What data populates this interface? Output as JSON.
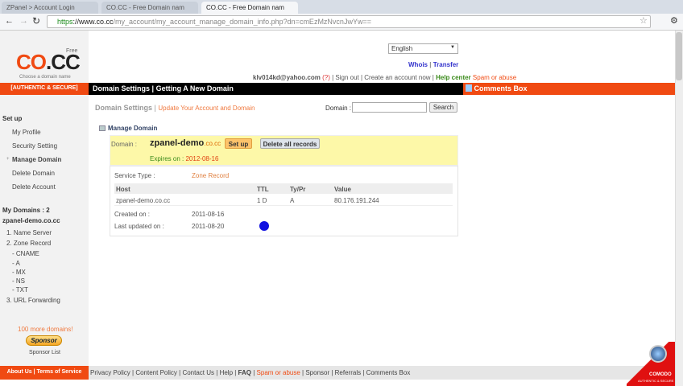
{
  "browser": {
    "tabs": [
      "ZPanel > Account Login",
      "CO.CC - Free Domain nam",
      "CO.CC - Free Domain nam"
    ],
    "url_scheme": "https",
    "url_host": "://www.co.cc",
    "url_path": "/my_account/my_account_manage_domain_info.php?dn=cmEzMzNvcnJwYw=="
  },
  "logo": {
    "free": "Free",
    "co": "CO",
    "cc": ".CC",
    "tagline": "Choose a domain name"
  },
  "header": {
    "language": "English",
    "whois": "Whois",
    "transfer": "Transfer",
    "email": "klv014kd@yahoo.com",
    "help_q": "(?)",
    "sign_out": "Sign out",
    "create": "Create an account now",
    "help_center": "Help center",
    "spam": "Spam or abuse"
  },
  "navbar": {
    "authentic": "[AUTHENTIC & SECURE]",
    "domain_settings": "Domain Settings",
    "sep": "|",
    "new_domain": "Getting A New Domain",
    "comments": "Comments Box"
  },
  "sidebar": {
    "setup": "Set up",
    "items": [
      "My Profile",
      "Security Setting",
      "Manage Domain",
      "Delete Domain",
      "Delete Account"
    ],
    "my_domains": "My Domains : 2",
    "domain": "zpanel-demo.co.cc",
    "sub": [
      "1. Name Server",
      "2. Zone Record",
      "- CNAME",
      "- A",
      "- MX",
      "- NS",
      "- TXT",
      "3. URL Forwarding"
    ],
    "more": "100 more domains!",
    "sponsor": "Sponsor",
    "sponsor_list": "Sponsor List"
  },
  "main": {
    "crumb1": "Domain Settings",
    "crumb2": "Update Your Account and Domain",
    "search_label": "Domain :",
    "search_value": "",
    "search_btn": "Search",
    "manage": "Manage Domain",
    "domain_label": "Domain :",
    "domain_name": "zpanel-demo",
    "domain_tld": ".co.cc",
    "setup_btn": "Set up",
    "delete_btn": "Delete all records",
    "expires_label": "Expires on :",
    "expires": "2012-08-16",
    "service_label": "Service Type :",
    "service": "Zone Record",
    "columns": [
      "Host",
      "TTL",
      "Ty/Pr",
      "Value"
    ],
    "row": [
      "zpanel-demo.co.cc",
      "1 D",
      "A",
      "80.176.191.244"
    ],
    "created_label": "Created on :",
    "created": "2011-08-16",
    "updated_label": "Last updated on :",
    "updated": "2011-08-20"
  },
  "footer": {
    "left": "About Us | Terms of Service",
    "links": [
      "Privacy Policy",
      "Content Policy",
      "Contact Us",
      "Help",
      "FAQ",
      "Spam or abuse",
      "Sponsor",
      "Referrals",
      "Comments Box"
    ],
    "badge": "COMODO",
    "badge_sub": "AUTHENTIC & SECURE"
  }
}
